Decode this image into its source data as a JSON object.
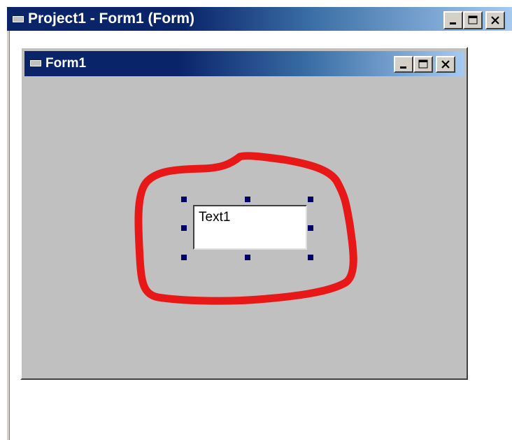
{
  "outer_window": {
    "title": "Project1 - Form1 (Form)",
    "icon": "form-window-icon",
    "buttons": [
      "minimize-icon",
      "maximize-icon",
      "close-icon"
    ]
  },
  "form_window": {
    "title": "Form1",
    "icon": "form-window-icon",
    "buttons": [
      "minimize-icon",
      "maximize-icon",
      "close-icon"
    ]
  },
  "textbox": {
    "text": "Text1",
    "selected": true
  },
  "annotation": {
    "shape": "hand-drawn-circle",
    "color": "#e81818"
  },
  "colors": {
    "titlebar_active": "#0a246a",
    "titlebar_gradient_end": "#a6caf0",
    "form_background": "#c0c0c0",
    "handle": "#000066"
  }
}
